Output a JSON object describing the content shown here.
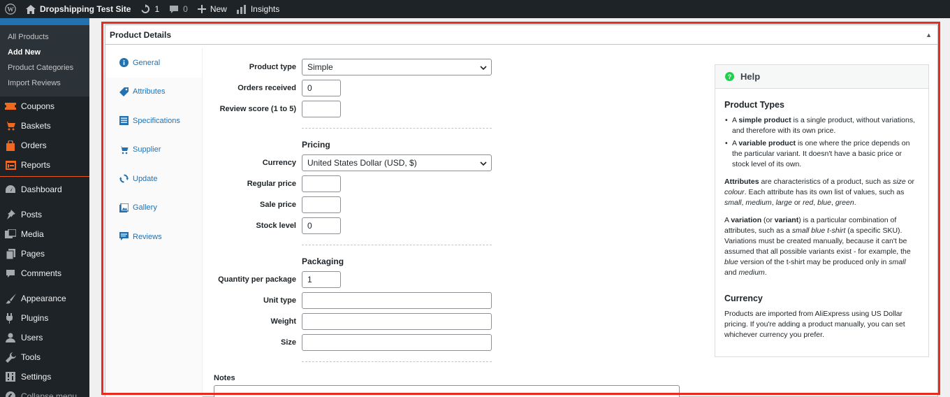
{
  "adminbar": {
    "site_name": "Dropshipping Test Site",
    "updates_count": "1",
    "comments_count": "0",
    "new_label": "New",
    "insights_label": "Insights"
  },
  "sidebar": {
    "submenu": [
      {
        "label": "All Products"
      },
      {
        "label": "Add New"
      },
      {
        "label": "Product Categories"
      },
      {
        "label": "Import Reviews"
      }
    ],
    "woo_items": [
      {
        "label": "Coupons",
        "icon": "coupon-icon"
      },
      {
        "label": "Baskets",
        "icon": "basket-icon"
      },
      {
        "label": "Orders",
        "icon": "bag-icon"
      },
      {
        "label": "Reports",
        "icon": "report-icon"
      }
    ],
    "dashboard": "Dashboard",
    "items_a": [
      {
        "label": "Posts"
      },
      {
        "label": "Media"
      },
      {
        "label": "Pages"
      },
      {
        "label": "Comments"
      }
    ],
    "items_b": [
      {
        "label": "Appearance"
      },
      {
        "label": "Plugins"
      },
      {
        "label": "Users"
      },
      {
        "label": "Tools"
      },
      {
        "label": "Settings"
      }
    ],
    "collapse": "Collapse menu"
  },
  "metabox": {
    "title": "Product Details",
    "tabs": [
      {
        "label": "General"
      },
      {
        "label": "Attributes"
      },
      {
        "label": "Specifications"
      },
      {
        "label": "Supplier"
      },
      {
        "label": "Update"
      },
      {
        "label": "Gallery"
      },
      {
        "label": "Reviews"
      }
    ]
  },
  "form": {
    "product_type_label": "Product type",
    "product_type_value": "Simple",
    "orders_received_label": "Orders received",
    "orders_received_value": "0",
    "review_score_label": "Review score (1 to 5)",
    "review_score_value": "",
    "pricing_heading": "Pricing",
    "currency_label": "Currency",
    "currency_value": "United States Dollar (USD, $)",
    "regular_price_label": "Regular price",
    "regular_price_value": "",
    "sale_price_label": "Sale price",
    "sale_price_value": "",
    "stock_level_label": "Stock level",
    "stock_level_value": "0",
    "packaging_heading": "Packaging",
    "qty_per_package_label": "Quantity per package",
    "qty_per_package_value": "1",
    "unit_type_label": "Unit type",
    "unit_type_value": "",
    "weight_label": "Weight",
    "weight_value": "",
    "size_label": "Size",
    "size_value": "",
    "notes_label": "Notes"
  },
  "help": {
    "title": "Help",
    "product_types_heading": "Product Types",
    "currency_heading": "Currency",
    "currency_text": "Products are imported from AliExpress using US Dollar pricing. If you're adding a product manually, you can set whichever currency you prefer."
  },
  "colors": {
    "accent": "#2271b1",
    "woo_orange": "#f0691e",
    "highlight_red": "#e92a1e",
    "help_green": "#1ed14b"
  }
}
